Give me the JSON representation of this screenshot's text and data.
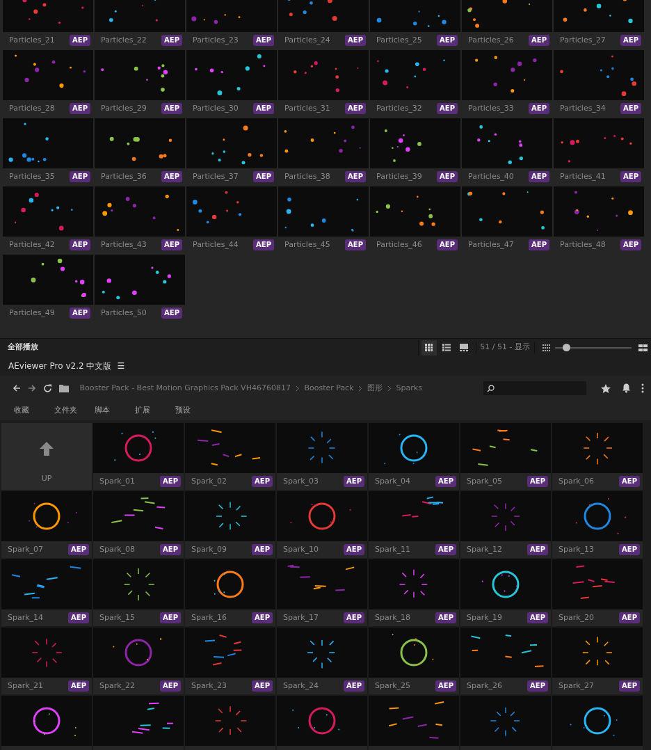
{
  "top_grid": {
    "items": [
      {
        "name": "Particles_21",
        "badge": "AEP"
      },
      {
        "name": "Particles_22",
        "badge": "AEP"
      },
      {
        "name": "Particles_23",
        "badge": "AEP"
      },
      {
        "name": "Particles_24",
        "badge": "AEP"
      },
      {
        "name": "Particles_25",
        "badge": "AEP"
      },
      {
        "name": "Particles_26",
        "badge": "AEP"
      },
      {
        "name": "Particles_27",
        "badge": "AEP"
      },
      {
        "name": "Particles_28",
        "badge": "AEP"
      },
      {
        "name": "Particles_29",
        "badge": "AEP"
      },
      {
        "name": "Particles_30",
        "badge": "AEP"
      },
      {
        "name": "Particles_31",
        "badge": "AEP"
      },
      {
        "name": "Particles_32",
        "badge": "AEP"
      },
      {
        "name": "Particles_33",
        "badge": "AEP"
      },
      {
        "name": "Particles_34",
        "badge": "AEP"
      },
      {
        "name": "Particles_35",
        "badge": "AEP"
      },
      {
        "name": "Particles_36",
        "badge": "AEP"
      },
      {
        "name": "Particles_37",
        "badge": "AEP"
      },
      {
        "name": "Particles_38",
        "badge": "AEP"
      },
      {
        "name": "Particles_39",
        "badge": "AEP"
      },
      {
        "name": "Particles_40",
        "badge": "AEP"
      },
      {
        "name": "Particles_41",
        "badge": "AEP"
      },
      {
        "name": "Particles_42",
        "badge": "AEP"
      },
      {
        "name": "Particles_43",
        "badge": "AEP"
      },
      {
        "name": "Particles_44",
        "badge": "AEP"
      },
      {
        "name": "Particles_45",
        "badge": "AEP"
      },
      {
        "name": "Particles_46",
        "badge": "AEP"
      },
      {
        "name": "Particles_47",
        "badge": "AEP"
      },
      {
        "name": "Particles_48",
        "badge": "AEP"
      },
      {
        "name": "Particles_49",
        "badge": "AEP"
      },
      {
        "name": "Particles_50",
        "badge": "AEP"
      }
    ]
  },
  "status_bar": {
    "play_all": "全部播放",
    "view_modes": [
      {
        "selected": true
      },
      {
        "selected": false
      },
      {
        "selected": false
      }
    ],
    "count": "51 / 51 - 显示",
    "size_slider": {
      "level": 0.15
    }
  },
  "app_header": {
    "title": "AEviewer Pro v2.2 中文版",
    "menu": "☰"
  },
  "breadcrumb": [
    "Booster Pack - Best Motion Graphics Pack VH46760817",
    "Booster Pack",
    "图形",
    "Sparks"
  ],
  "tabs": [
    "收藏",
    "文件夹",
    "脚本",
    "扩展",
    "预设"
  ],
  "bottom_grid": {
    "items": [
      {
        "kind": "up",
        "name": "UP"
      },
      {
        "kind": "asset",
        "name": "Spark_01",
        "badge": "AEP"
      },
      {
        "kind": "asset",
        "name": "Spark_02",
        "badge": "AEP"
      },
      {
        "kind": "asset",
        "name": "Spark_03",
        "badge": "AEP"
      },
      {
        "kind": "asset",
        "name": "Spark_04",
        "badge": "AEP"
      },
      {
        "kind": "asset",
        "name": "Spark_05",
        "badge": "AEP"
      },
      {
        "kind": "asset",
        "name": "Spark_06",
        "badge": "AEP"
      },
      {
        "kind": "asset",
        "name": "Spark_07",
        "badge": "AEP"
      },
      {
        "kind": "asset",
        "name": "Spark_08",
        "badge": "AEP"
      },
      {
        "kind": "asset",
        "name": "Spark_09",
        "badge": "AEP"
      },
      {
        "kind": "asset",
        "name": "Spark_10",
        "badge": "AEP"
      },
      {
        "kind": "asset",
        "name": "Spark_11",
        "badge": "AEP"
      },
      {
        "kind": "asset",
        "name": "Spark_12",
        "badge": "AEP"
      },
      {
        "kind": "asset",
        "name": "Spark_13",
        "badge": "AEP"
      },
      {
        "kind": "asset",
        "name": "Spark_14",
        "badge": "AEP"
      },
      {
        "kind": "asset",
        "name": "Spark_15",
        "badge": "AEP"
      },
      {
        "kind": "asset",
        "name": "Spark_16",
        "badge": "AEP"
      },
      {
        "kind": "asset",
        "name": "Spark_17",
        "badge": "AEP"
      },
      {
        "kind": "asset",
        "name": "Spark_18",
        "badge": "AEP"
      },
      {
        "kind": "asset",
        "name": "Spark_19",
        "badge": "AEP"
      },
      {
        "kind": "asset",
        "name": "Spark_20",
        "badge": "AEP"
      },
      {
        "kind": "asset",
        "name": "Spark_21",
        "badge": "AEP"
      },
      {
        "kind": "asset",
        "name": "Spark_22",
        "badge": "AEP"
      },
      {
        "kind": "asset",
        "name": "Spark_23",
        "badge": "AEP"
      },
      {
        "kind": "asset",
        "name": "Spark_24",
        "badge": "AEP"
      },
      {
        "kind": "asset",
        "name": "Spark_25",
        "badge": "AEP"
      },
      {
        "kind": "asset",
        "name": "Spark_26",
        "badge": "AEP"
      },
      {
        "kind": "asset",
        "name": "Spark_27",
        "badge": "AEP"
      },
      {
        "kind": "preview"
      },
      {
        "kind": "preview"
      },
      {
        "kind": "preview"
      },
      {
        "kind": "preview"
      },
      {
        "kind": "preview"
      },
      {
        "kind": "preview"
      },
      {
        "kind": "preview"
      }
    ]
  }
}
